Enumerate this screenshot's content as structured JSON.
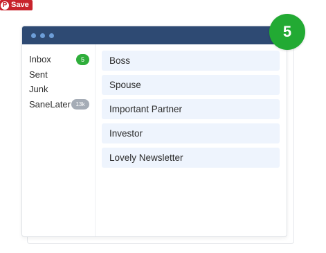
{
  "save_badge": {
    "icon": "pinterest-icon",
    "label": "Save"
  },
  "sidebar": {
    "items": [
      {
        "label": "Inbox",
        "badge": "5",
        "badge_color": "#2fae3b"
      },
      {
        "label": "Sent"
      },
      {
        "label": "Junk"
      },
      {
        "label": "SaneLater",
        "badge": "13k",
        "badge_color": "#a5acb6"
      }
    ]
  },
  "messages": [
    {
      "sender": "Boss"
    },
    {
      "sender": "Spouse"
    },
    {
      "sender": "Important Partner"
    },
    {
      "sender": "Investor"
    },
    {
      "sender": "Lovely Newsletter"
    }
  ],
  "count_bubble": {
    "value": "5",
    "color": "#22aa33"
  },
  "colors": {
    "titlebar": "#2e4a73",
    "dots": "#6d9ed8",
    "item_bg": "#eef4fd"
  }
}
